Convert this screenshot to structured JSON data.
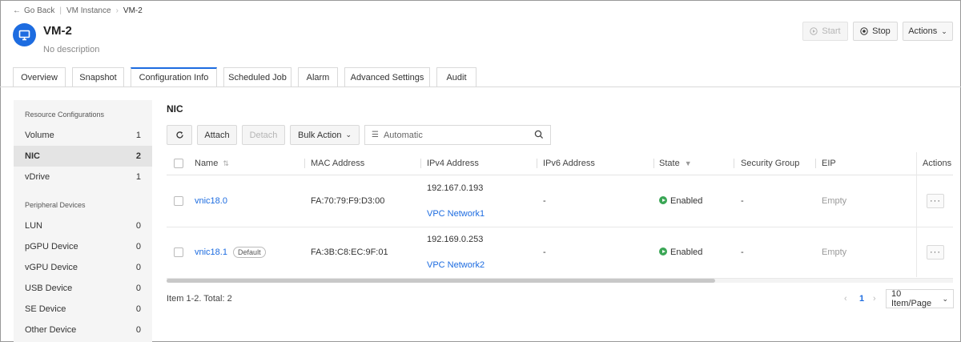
{
  "breadcrumb": {
    "back": "Go Back",
    "parent": "VM Instance",
    "current": "VM-2"
  },
  "header": {
    "title": "VM-2",
    "description": "No description"
  },
  "header_actions": {
    "start": "Start",
    "stop": "Stop",
    "actions": "Actions"
  },
  "tabs": [
    {
      "label": "Overview"
    },
    {
      "label": "Snapshot"
    },
    {
      "label": "Configuration Info"
    },
    {
      "label": "Scheduled Job"
    },
    {
      "label": "Alarm"
    },
    {
      "label": "Advanced Settings"
    },
    {
      "label": "Audit"
    }
  ],
  "active_tab": "Configuration Info",
  "sidebar": {
    "resource_title": "Resource Configurations",
    "resource_items": [
      {
        "label": "Volume",
        "count": "1"
      },
      {
        "label": "NIC",
        "count": "2"
      },
      {
        "label": "vDrive",
        "count": "1"
      }
    ],
    "peripheral_title": "Peripheral Devices",
    "peripheral_items": [
      {
        "label": "LUN",
        "count": "0"
      },
      {
        "label": "pGPU Device",
        "count": "0"
      },
      {
        "label": "vGPU Device",
        "count": "0"
      },
      {
        "label": "USB Device",
        "count": "0"
      },
      {
        "label": "SE Device",
        "count": "0"
      },
      {
        "label": "Other Device",
        "count": "0"
      }
    ]
  },
  "section_title": "NIC",
  "toolbar": {
    "attach": "Attach",
    "detach": "Detach",
    "bulk_action": "Bulk Action",
    "filter_value": "Automatic"
  },
  "table": {
    "columns": [
      "Name",
      "MAC Address",
      "IPv4 Address",
      "IPv6 Address",
      "State",
      "Security Group",
      "EIP",
      "Actions"
    ],
    "rows": [
      {
        "name": "vnic18.0",
        "badge": "",
        "mac": "FA:70:79:F9:D3:00",
        "ipv4": "192.167.0.193",
        "network": "VPC Network1",
        "ipv6": "-",
        "state": "Enabled",
        "security_group": "-",
        "eip": "Empty",
        "more": "···"
      },
      {
        "name": "vnic18.1",
        "badge": "Default",
        "mac": "FA:3B:C8:EC:9F:01",
        "ipv4": "192.169.0.253",
        "network": "VPC Network2",
        "ipv6": "-",
        "state": "Enabled",
        "security_group": "-",
        "eip": "Empty",
        "more": "···"
      }
    ]
  },
  "pagination": {
    "total": "Item 1-2. Total: 2",
    "current_page": "1",
    "page_size": "10 Item/Page"
  },
  "colors": {
    "accent": "#1d6ce0",
    "enabled": "#3aa655"
  }
}
